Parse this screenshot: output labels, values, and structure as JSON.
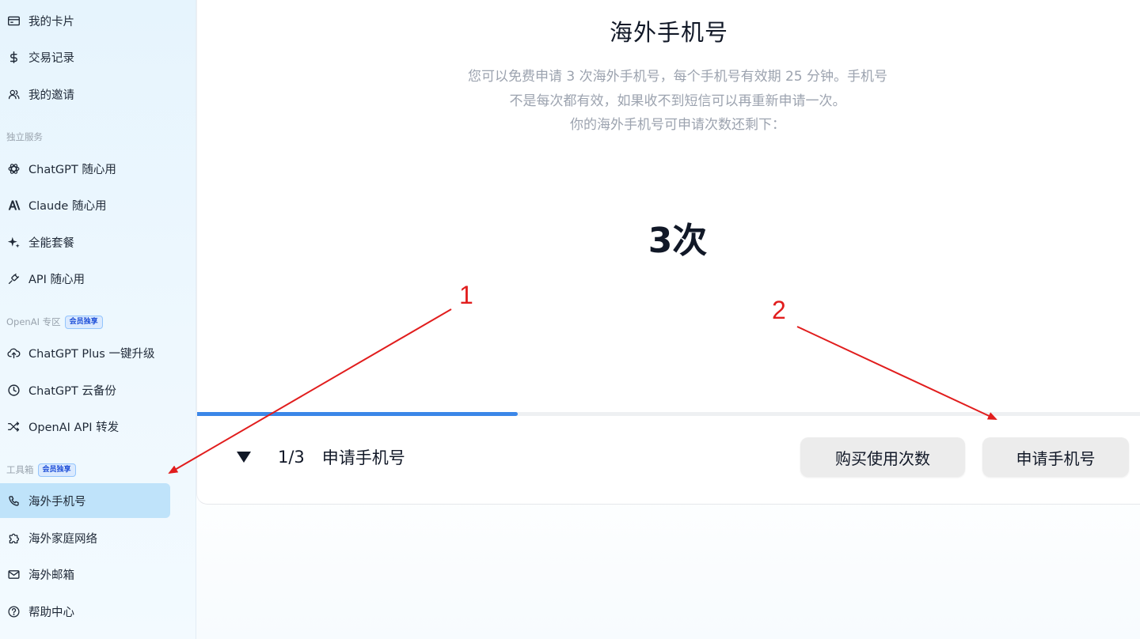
{
  "sidebar": {
    "items_top": [
      {
        "label": "我的卡片",
        "icon": "card-icon"
      },
      {
        "label": "交易记录",
        "icon": "dollar-icon"
      },
      {
        "label": "我的邀请",
        "icon": "users-icon"
      }
    ],
    "section_services": {
      "title": "独立服务"
    },
    "items_services": [
      {
        "label": "ChatGPT 随心用",
        "icon": "openai-icon"
      },
      {
        "label": "Claude 随心用",
        "icon": "anthropic-icon"
      },
      {
        "label": "全能套餐",
        "icon": "sparkle-icon"
      },
      {
        "label": "API 随心用",
        "icon": "plug-icon"
      }
    ],
    "section_openai": {
      "title": "OpenAI 专区",
      "badge": "会员独享"
    },
    "items_openai": [
      {
        "label": "ChatGPT Plus 一键升级",
        "icon": "cloud-upload-icon"
      },
      {
        "label": "ChatGPT 云备份",
        "icon": "clock-icon"
      },
      {
        "label": "OpenAI API 转发",
        "icon": "shuffle-icon"
      }
    ],
    "section_tools": {
      "title": "工具箱",
      "badge": "会员独享"
    },
    "items_tools": [
      {
        "label": "海外手机号",
        "icon": "phone-icon",
        "active": true
      },
      {
        "label": "海外家庭网络",
        "icon": "puzzle-icon"
      },
      {
        "label": "海外邮箱",
        "icon": "mail-icon"
      },
      {
        "label": "帮助中心",
        "icon": "help-icon"
      }
    ]
  },
  "main": {
    "title": "海外手机号",
    "description_lines": [
      "您可以免费申请 3 次海外手机号，每个手机号有效期 25 分钟。手机号",
      "不是每次都有效，如果收不到短信可以再重新申请一次。",
      "你的海外手机号可申请次数还剩下："
    ],
    "remaining": "3次",
    "progress": {
      "current": 1,
      "total": 3,
      "fraction": 0.34
    },
    "step": {
      "count": "1/3",
      "title": "申请手机号"
    },
    "buttons": {
      "buy": "购买使用次数",
      "apply": "申请手机号"
    }
  },
  "annotations": [
    {
      "label": "1",
      "color": "#e11d1d"
    },
    {
      "label": "2",
      "color": "#e11d1d"
    }
  ],
  "colors": {
    "accent": "#3b87e8",
    "active_nav": "#bfe3fa",
    "annotation": "#e11d1d"
  }
}
